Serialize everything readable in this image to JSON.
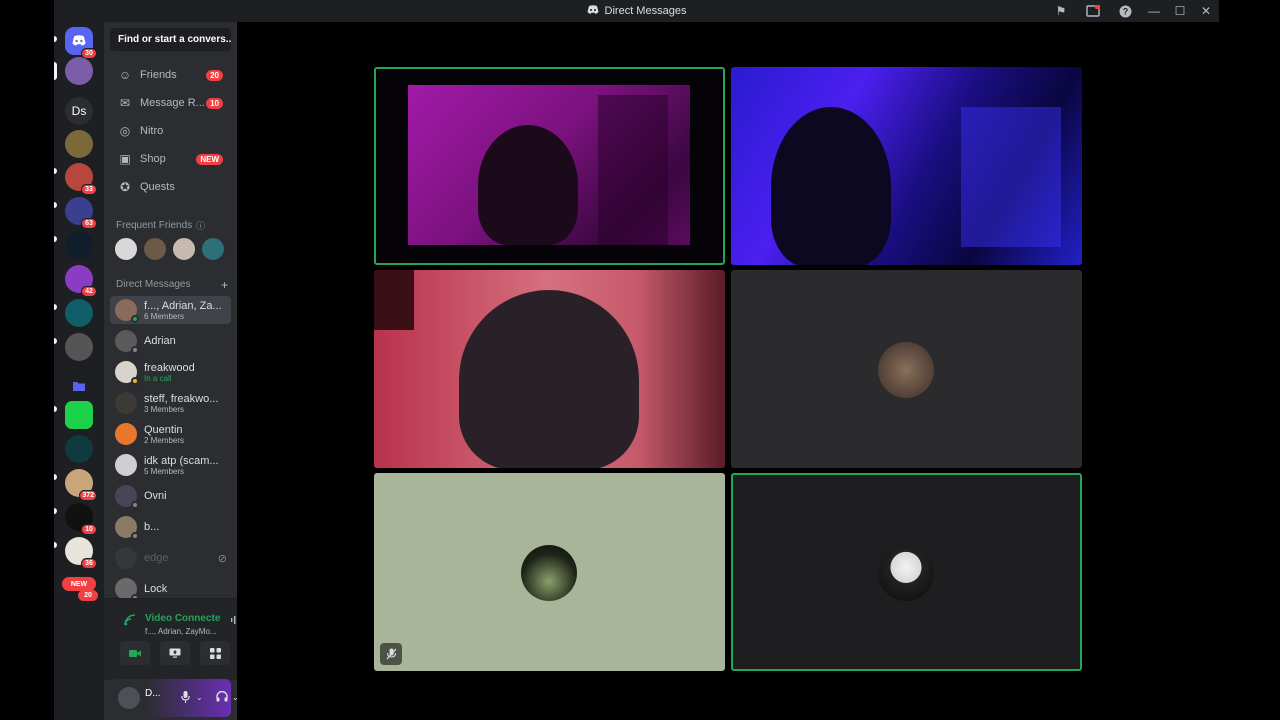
{
  "titlebar": {
    "title": "Direct Messages"
  },
  "guilds": {
    "home_badge": "30",
    "ds_label": "Ds",
    "badges": [
      "33",
      "63",
      "42",
      "372",
      "10",
      "36",
      "20"
    ],
    "new_pill": "NEW"
  },
  "sidebar": {
    "search_placeholder": "Find or start a convers...",
    "nav": [
      {
        "label": "Friends",
        "badge": "20",
        "icon": "friends-icon"
      },
      {
        "label": "Message R...",
        "badge": "10",
        "icon": "envelope-icon"
      },
      {
        "label": "Nitro",
        "badge": "",
        "icon": "nitro-icon"
      },
      {
        "label": "Shop",
        "badge": "NEW",
        "icon": "shop-icon"
      },
      {
        "label": "Quests",
        "badge": "",
        "icon": "quests-icon"
      }
    ],
    "frequent_friends_label": "Frequent Friends",
    "direct_messages_label": "Direct Messages",
    "dms": [
      {
        "name": "f..., Adrian, Za...",
        "sub": "6 Members",
        "active": true
      },
      {
        "name": "Adrian",
        "sub": ""
      },
      {
        "name": "freakwood",
        "sub": "In a call",
        "sub_green": true
      },
      {
        "name": "steff, freakwo...",
        "sub": "3 Members"
      },
      {
        "name": "Quentin",
        "sub": "2 Members"
      },
      {
        "name": "idk atp (scam...",
        "sub": "5 Members"
      },
      {
        "name": "Ovni",
        "sub": ""
      },
      {
        "name": "b...",
        "sub": ""
      },
      {
        "name": "edge",
        "sub": "",
        "faded": true
      },
      {
        "name": "Lock",
        "sub": ""
      }
    ]
  },
  "voice": {
    "status": "Video Connecte",
    "channel": "f..., Adrian, ZayMo..."
  },
  "user": {
    "name": "D..."
  },
  "colors": {
    "accent_green": "#23a55a",
    "badge_red": "#f23f43",
    "blurple": "#5865f2"
  }
}
